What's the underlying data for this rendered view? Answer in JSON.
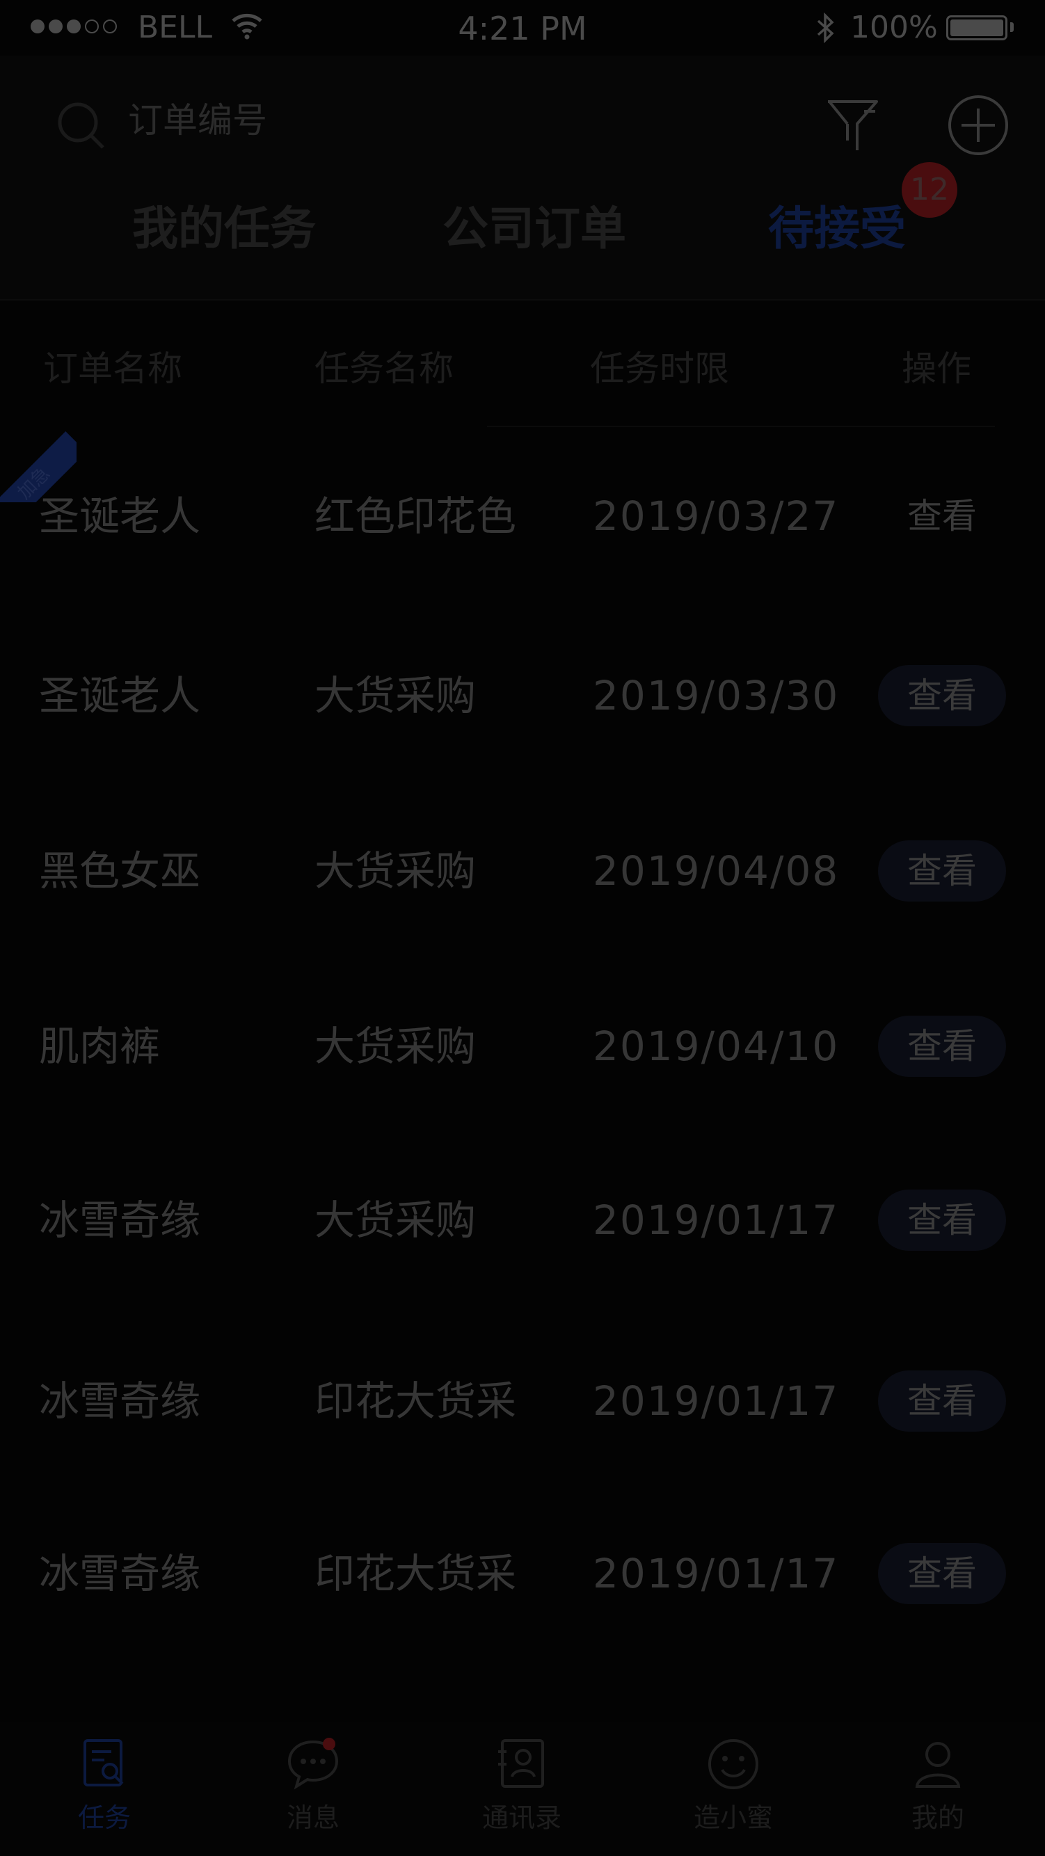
{
  "status_bar": {
    "carrier": "BELL",
    "time": "4:21 PM",
    "battery": "100%"
  },
  "search": {
    "placeholder": "订单编号"
  },
  "tabs": [
    {
      "label": "我的任务"
    },
    {
      "label": "公司订单"
    },
    {
      "label": "待接受",
      "badge": "12",
      "active": true
    }
  ],
  "table": {
    "headers": [
      "订单名称",
      "任务名称",
      "任务时限",
      "操作"
    ],
    "ribbon_label": "加急",
    "rows": [
      {
        "order": "圣诞老人",
        "task": "红色印花色",
        "deadline": "2019/03/27",
        "action": "查看"
      },
      {
        "order": "圣诞老人",
        "task": "大货采购",
        "deadline": "2019/03/30",
        "action": "查看"
      },
      {
        "order": "黑色女巫",
        "task": "大货采购",
        "deadline": "2019/04/08",
        "action": "查看"
      },
      {
        "order": "肌肉裤",
        "task": "大货采购",
        "deadline": "2019/04/10",
        "action": "查看"
      },
      {
        "order": "冰雪奇缘",
        "task": "大货采购",
        "deadline": "2019/01/17",
        "action": "查看"
      },
      {
        "order": "冰雪奇缘",
        "task": "印花大货采",
        "deadline": "2019/01/17",
        "action": "查看"
      },
      {
        "order": "冰雪奇缘",
        "task": "印花大货采",
        "deadline": "2019/01/17",
        "action": "查看"
      }
    ]
  },
  "bottom_nav": [
    {
      "label": "任务",
      "icon": "task-icon",
      "active": true
    },
    {
      "label": "消息",
      "icon": "message-icon"
    },
    {
      "label": "通讯录",
      "icon": "contacts-icon"
    },
    {
      "label": "造小蜜",
      "icon": "smile-icon"
    },
    {
      "label": "我的",
      "icon": "user-icon"
    }
  ],
  "colors": {
    "background": "#030303",
    "accent": "#0c1a40",
    "badge": "#4a0d0f"
  }
}
